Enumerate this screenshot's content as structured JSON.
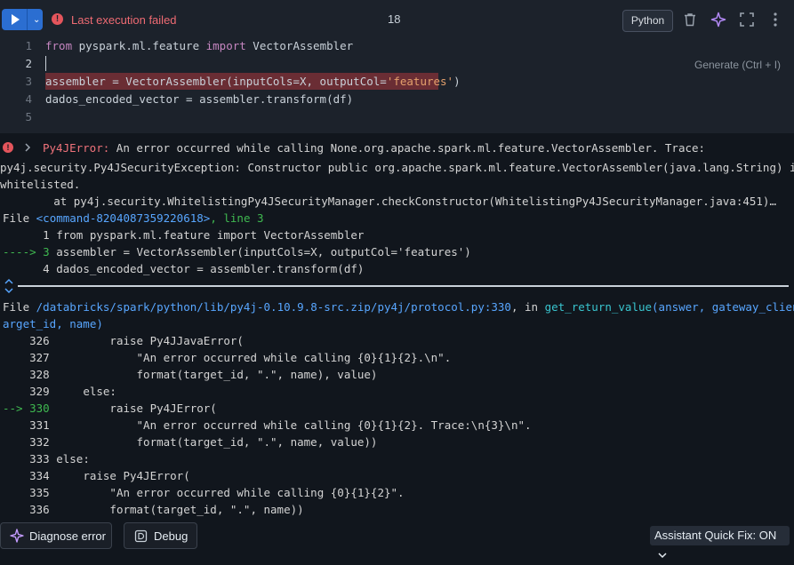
{
  "header": {
    "status_text": "Last execution failed",
    "cell_number": "18",
    "language_label": "Python"
  },
  "editor": {
    "line_numbers": [
      "1",
      "2",
      "3",
      "4",
      "5"
    ],
    "lines": [
      {
        "kw1": "from",
        "mid": " pyspark.ml.feature ",
        "kw2": "import",
        "rest": " VectorAssembler"
      },
      {
        "text": ""
      },
      {
        "pre": "assembler = VectorAssembler(inputCols=X, outputCol=",
        "str": "'features'",
        "post": ")"
      },
      {
        "text": "dados_encoded_vector = assembler.transform(df)"
      },
      {
        "text": ""
      }
    ],
    "generate_hint": "Generate (Ctrl + I)"
  },
  "output": {
    "error_type": "Py4JError:",
    "error_message": " An error occurred while calling None.org.apache.spark.ml.feature.VectorAssembler. Trace:",
    "security_line1": "py4j.security.Py4JSecurityException: Constructor public org.apache.spark.ml.feature.VectorAssembler(java.lang.String) is not",
    "security_line2": "whitelisted.",
    "at_line": "        at py4j.security.WhitelistingPy4JSecurityManager.checkConstructor(WhitelistingPy4JSecurityManager.java:451)…",
    "file1": {
      "prefix": "File ",
      "link": "<command-8204087359220618>",
      "suffix": ", line 3"
    },
    "snippet1": [
      {
        "marker": "      ",
        "num": "1",
        "code": " from pyspark.ml.feature import VectorAssembler"
      },
      {
        "marker": "----> ",
        "num": "3",
        "code": " assembler = VectorAssembler(inputCols=X, outputCol='features')"
      },
      {
        "marker": "      ",
        "num": "4",
        "code": " dados_encoded_vector = assembler.transform(df)"
      }
    ],
    "file2": {
      "prefix": "File ",
      "path": "/databricks/spark/python/lib/py4j-0.10.9.8-src.zip/py4j/protocol.py:330",
      "mid": ", in ",
      "func": "get_return_value",
      "args_line1": "(answer, gateway_client, t",
      "args_line2": "arget_id, name)"
    },
    "snippet2": [
      {
        "marker": "    ",
        "num": "326",
        "code": "         raise Py4JJavaError("
      },
      {
        "marker": "    ",
        "num": "327",
        "code": "             \"An error occurred while calling {0}{1}{2}.\\n\"."
      },
      {
        "marker": "    ",
        "num": "328",
        "code": "             format(target_id, \".\", name), value)"
      },
      {
        "marker": "    ",
        "num": "329",
        "code": "     else:"
      },
      {
        "marker": "--> ",
        "num": "330",
        "code": "         raise Py4JError("
      },
      {
        "marker": "    ",
        "num": "331",
        "code": "             \"An error occurred while calling {0}{1}{2}. Trace:\\n{3}\\n\"."
      },
      {
        "marker": "    ",
        "num": "332",
        "code": "             format(target_id, \".\", name, value))"
      },
      {
        "marker": "    ",
        "num": "333",
        "code": " else:"
      },
      {
        "marker": "    ",
        "num": "334",
        "code": "     raise Py4JError("
      },
      {
        "marker": "    ",
        "num": "335",
        "code": "         \"An error occurred while calling {0}{1}{2}\"."
      },
      {
        "marker": "    ",
        "num": "336",
        "code": "         format(target_id, \".\", name))"
      }
    ]
  },
  "footer": {
    "diagnose_label": "Diagnose error",
    "debug_label": "Debug",
    "quick_fix_label": "Assistant Quick Fix: ON"
  },
  "icons": {
    "run": "play-icon",
    "run_menu": "chevron-down-icon",
    "status": "error-icon",
    "delete": "trash-icon",
    "assistant": "sparkle-icon",
    "expand": "fullscreen-icon",
    "more": "kebab-menu-icon",
    "expand_traceback": "chevron-right-icon",
    "collapse_frames": "expand-collapse-icon",
    "debug": "debug-icon"
  },
  "colors": {
    "run_button": "#2b6ed1",
    "error_red": "#f0737b",
    "link_blue": "#58a6ff",
    "arrow_green": "#3fb950",
    "line_highlight": "#6a2d34"
  }
}
